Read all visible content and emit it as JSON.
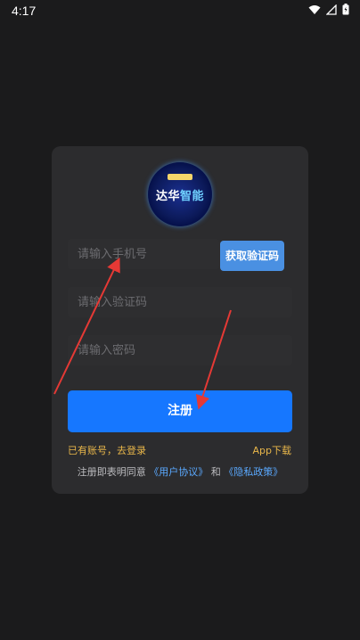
{
  "status_bar": {
    "time": "4:17"
  },
  "logo": {
    "text_main": "达华",
    "text_highlight": "智能"
  },
  "form": {
    "phone_placeholder": "请输入手机号",
    "code_placeholder": "请输入验证码",
    "password_placeholder": "请输入密码",
    "get_code_label": "获取验证码",
    "register_label": "注册"
  },
  "links": {
    "login": "已有账号，去登录",
    "app_download": "App下载"
  },
  "agreement": {
    "prefix": "注册即表明同意",
    "user_agreement": "《用户协议》",
    "and": "和",
    "privacy_policy": "《隐私政策》"
  },
  "colors": {
    "background": "#1b1b1c",
    "card": "#2c2c2e",
    "primary": "#1677ff",
    "code_button": "#4a90e2",
    "link_gold": "#e8b64a",
    "link_blue": "#5aa9ff",
    "annotation_arrow": "#e53935"
  }
}
